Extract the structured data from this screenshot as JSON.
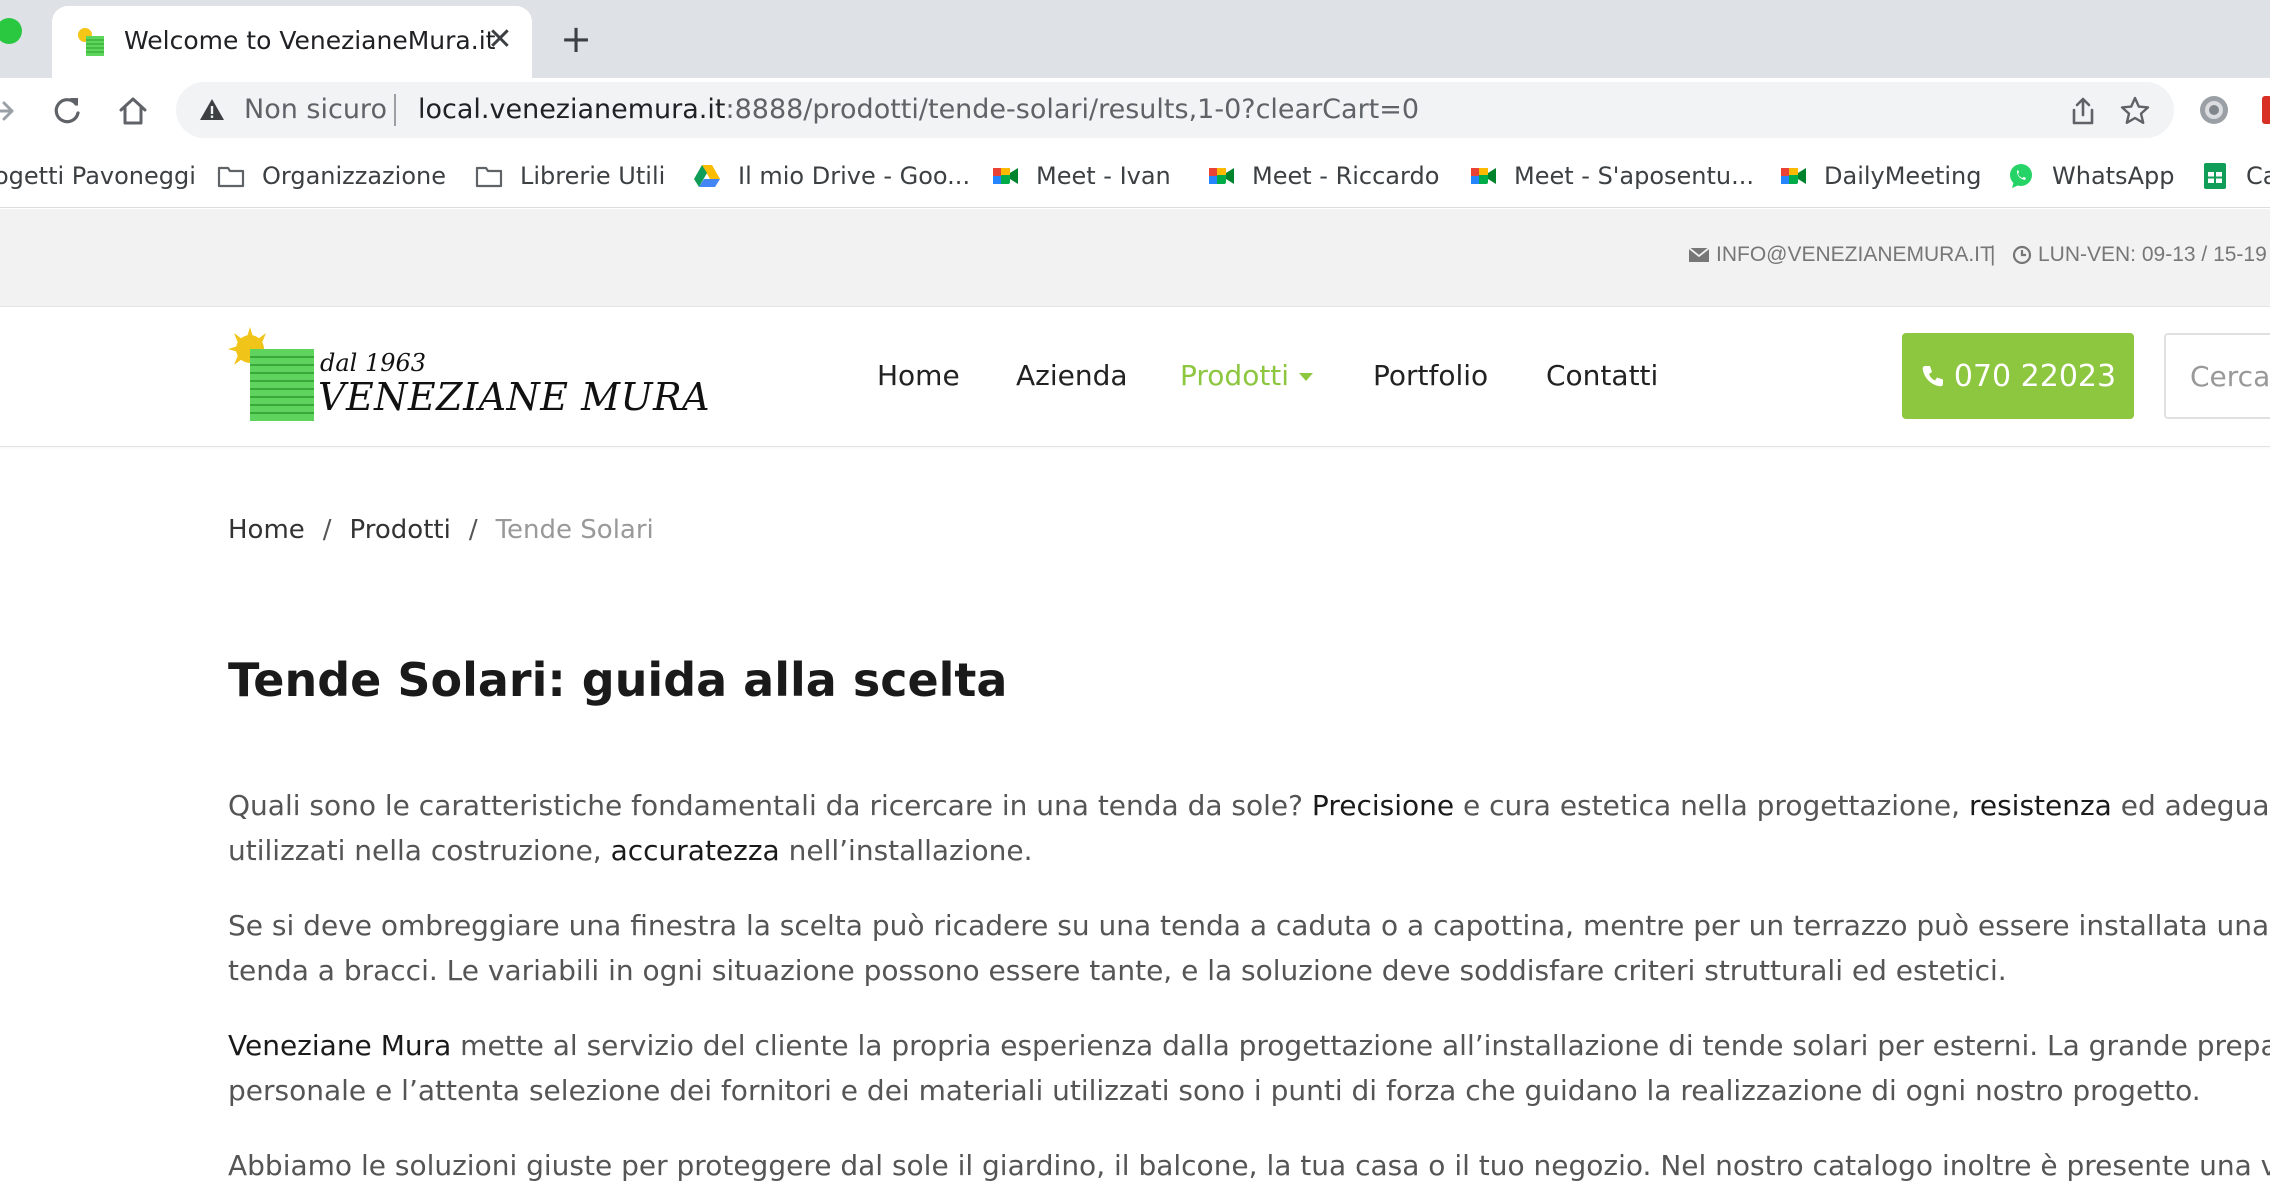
{
  "browser": {
    "tab_title": "Welcome to VenezianeMura.it",
    "tab_close": "✕",
    "new_tab": "+",
    "security_label": "Non sicuro",
    "url_host": "local.venezianemura.it",
    "url_path": ":8888/prodotti/tende-solari/results,1-0?clearCart=0",
    "bookmarks": [
      {
        "label": "ogetti Pavoneggi",
        "icon": "none"
      },
      {
        "label": "Organizzazione",
        "icon": "folder-icon"
      },
      {
        "label": "Librerie Utili",
        "icon": "folder-icon"
      },
      {
        "label": "Il mio Drive - Goo...",
        "icon": "google-drive-icon"
      },
      {
        "label": "Meet -  Ivan",
        "icon": "google-meet-icon"
      },
      {
        "label": "Meet - Riccardo",
        "icon": "google-meet-icon"
      },
      {
        "label": "Meet - S'aposentu...",
        "icon": "google-meet-icon"
      },
      {
        "label": "DailyMeeting",
        "icon": "google-meet-icon"
      },
      {
        "label": "WhatsApp",
        "icon": "whatsapp-icon"
      },
      {
        "label": "Ca",
        "icon": "google-sheets-icon"
      }
    ]
  },
  "site": {
    "topbar": {
      "email": "INFO@VENEZIANEMURA.IT",
      "pipe": "|",
      "hours": "LUN-VEN: 09-13 / 15-19"
    },
    "logo": {
      "since": "dal 1963",
      "name": "VENEZIANE MURA"
    },
    "nav": [
      {
        "label": "Home"
      },
      {
        "label": "Azienda"
      },
      {
        "label": "Prodotti",
        "active": true
      },
      {
        "label": "Portfolio"
      },
      {
        "label": "Contatti"
      }
    ],
    "phone": "070 22023",
    "search_placeholder": "Cerca...",
    "breadcrumb": {
      "home": "Home",
      "sep": "/",
      "section": "Prodotti",
      "current": "Tende Solari"
    },
    "title": "Tende Solari: guida alla scelta",
    "paragraphs": {
      "p1": {
        "a": "Quali sono le caratteristiche fondamentali da ricercare in una tenda da sole? ",
        "b": "Precisione",
        "c": " e cura estetica nella progettazione, ",
        "d": "resistenza",
        "e": " ed adeguatezza dei materiali",
        "f": "utilizzati nella costruzione, ",
        "g": "accuratezza",
        "h": " nell’installazione."
      },
      "p2": {
        "line1": "Se si deve ombreggiare una finestra la scelta può ricadere su una tenda a caduta o a capottina, mentre per un terrazzo può essere installata una pergola o una",
        "line2": "tenda a bracci. Le variabili in ogni situazione possono essere tante, e la soluzione deve soddisfare criteri strutturali ed estetici."
      },
      "p3": {
        "strong": "Veneziane Mura",
        "line1": " mette al servizio del cliente la propria esperienza dalla progettazione all’installazione di tende solari per esterni. La grande preparazione del",
        "line2": "personale e l’attenta selezione dei fornitori e dei materiali utilizzati sono i punti di forza che guidano la realizzazione di ogni nostro progetto."
      },
      "p4": {
        "line1": "Abbiamo le soluzioni giuste per proteggere dal sole il giardino, il balcone, la tua casa o il tuo negozio. Nel nostro catalogo inoltre è presente una vasta gamma"
      }
    },
    "colors": {
      "accent": "#8dc63f",
      "text": "#555555",
      "heading": "#1a1a1a"
    }
  }
}
